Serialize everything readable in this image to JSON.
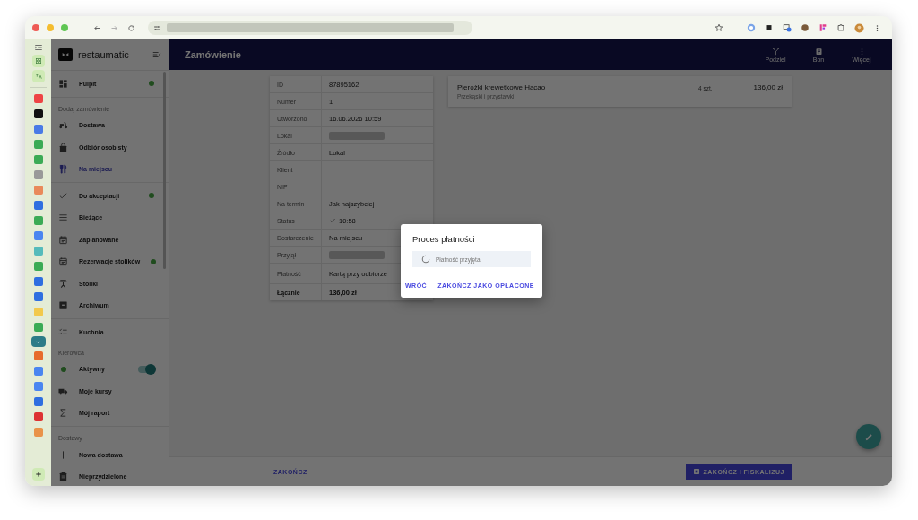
{
  "sidebar": {
    "logo": "restaumatic",
    "groups": [
      {
        "items": [
          {
            "kind": "link",
            "label": "Pulpit",
            "selected": false,
            "indicator": true
          }
        ]
      },
      {
        "items": [
          {
            "kind": "heading",
            "label": "Dodaj zamówienie"
          },
          {
            "kind": "link",
            "label": "Dostawa",
            "selected": false,
            "indicator": false
          },
          {
            "kind": "link",
            "label": "Odbiór osobisty",
            "selected": false,
            "indicator": false
          },
          {
            "kind": "link",
            "label": "Na miejscu",
            "selected": true,
            "indicator": false
          }
        ]
      },
      {
        "items": [
          {
            "kind": "link",
            "label": "Do akceptacji",
            "selected": false,
            "indicator": true
          },
          {
            "kind": "link",
            "label": "Bieżące",
            "selected": false,
            "indicator": false
          },
          {
            "kind": "link",
            "label": "Zaplanowane",
            "selected": false,
            "indicator": false
          },
          {
            "kind": "link",
            "label": "Rezerwacje stolików",
            "selected": false,
            "indicator": true
          },
          {
            "kind": "link",
            "label": "Stoliki",
            "selected": false,
            "indicator": false
          },
          {
            "kind": "link",
            "label": "Archiwum",
            "selected": false,
            "indicator": false
          }
        ]
      },
      {
        "items": [
          {
            "kind": "link",
            "label": "Kuchnia",
            "selected": false,
            "indicator": false
          },
          {
            "kind": "heading",
            "label": "Kierowca"
          },
          {
            "kind": "toggle",
            "label": "Aktywny",
            "on": true
          },
          {
            "kind": "link",
            "label": "Moje kursy",
            "selected": false,
            "indicator": false
          },
          {
            "kind": "link",
            "label": "Mój raport",
            "selected": false,
            "indicator": false
          }
        ]
      },
      {
        "items": [
          {
            "kind": "heading",
            "label": "Dostawy"
          },
          {
            "kind": "link",
            "label": "Nowa dostawa",
            "selected": false,
            "indicator": false
          },
          {
            "kind": "link",
            "label": "Nieprzydzielone",
            "selected": false,
            "indicator": false
          }
        ]
      }
    ]
  },
  "header": {
    "title": "Zamówienie",
    "actions": [
      "Podziel",
      "Bon",
      "Więcej"
    ]
  },
  "details": [
    {
      "label": "ID",
      "value": "87895162"
    },
    {
      "label": "Numer",
      "value": "1"
    },
    {
      "label": "Utworzono",
      "value": "16.06.2026 10:59"
    },
    {
      "label": "Lokal",
      "redacted": true
    },
    {
      "label": "Źródło",
      "value": "Lokal"
    },
    {
      "label": "Klient"
    },
    {
      "label": "NIP"
    },
    {
      "label": "Na termin",
      "value": "Jak najszybciej"
    },
    {
      "label": "Status",
      "value": "10:58",
      "check": true
    },
    {
      "label": "Dostarczenie",
      "value": "Na miejscu"
    },
    {
      "label": "Przyjął",
      "redacted": true
    },
    {
      "label": "Płatność",
      "value": "Kartą przy odbiorze"
    },
    {
      "label": "Łącznie",
      "value": "136,00 zł",
      "total": true
    }
  ],
  "order_items": [
    {
      "name": "Pierożki krewetkowe Hacao",
      "category": "Przekąski i przystawki",
      "quantity": "4 szt.",
      "price": "136,00 zł"
    }
  ],
  "footer": {
    "finish": "ZAKOŃCZ",
    "fiscalize": "ZAKOŃCZ I FISKALIZUJ"
  },
  "dialog": {
    "title": "Proces płatności",
    "status": "Płatność przyjęta",
    "buttons": [
      "WRÓĆ",
      "ZAKOŃCZ JAKO OPŁACONE"
    ]
  }
}
